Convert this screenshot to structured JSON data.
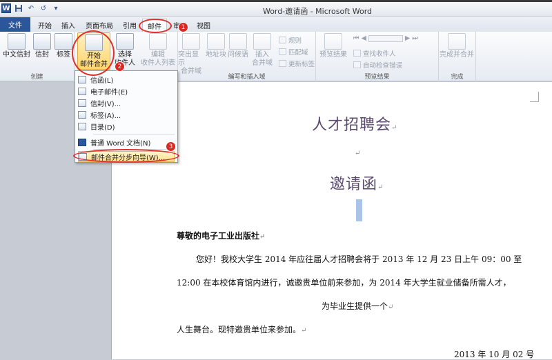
{
  "window": {
    "title": "Word-邀请函 - Microsoft Word",
    "logo_letter": "W"
  },
  "qat": {
    "undo": "↶",
    "redo": "↺",
    "more": "▾"
  },
  "tabs": [
    "文件",
    "开始",
    "插入",
    "页面布局",
    "引用",
    "邮件",
    "审阅",
    "视图"
  ],
  "ribbon": {
    "create": {
      "label": "创建",
      "envelope_cn": "中文信封",
      "envelope": "信封",
      "labels": "标签"
    },
    "start": {
      "line1": "开始",
      "line2": "邮件合并",
      "select1": "选择",
      "select2": "收件人",
      "edit1": "编辑",
      "edit2": "收件人列表",
      "group_label": ""
    },
    "write": {
      "label": "编写和插入域",
      "highlight1": "突出显示",
      "highlight2": "合并域",
      "address": "地址块",
      "greeting": "问候语",
      "insert1": "插入",
      "insert2": "合并域",
      "rules": "规则",
      "match": "匹配域",
      "update": "更新标签"
    },
    "preview": {
      "label": "预览结果",
      "results": "预览结果",
      "find": "查找收件人",
      "check": "自动检查错误"
    },
    "finish": {
      "label": "完成",
      "merge1": "完成并合并"
    }
  },
  "menu": {
    "items": [
      "信函(L)",
      "电子邮件(E)",
      "信封(V)...",
      "标签(A)...",
      "目录(D)",
      "普通 Word 文档(N)",
      "邮件合并分步向导(W)..."
    ]
  },
  "badges": [
    "1",
    "2",
    "3"
  ],
  "document": {
    "title1": "人才招聘会",
    "title2": "邀请函",
    "salutation": "尊敬的电子工业出版社",
    "p1": "您好！我校大学生 2014 年应往届人才招聘会将于 2013 年 12 月 23 日上午 09：00 至",
    "p2": "12:00 在本校体育馆内进行，诚邀贵单位前来参加，为 2014 年大学生就业储备所需人才，",
    "p3": "为毕业生提供一个",
    "p4": "人生舞台。现特邀贵单位来参加。",
    "date": "2013 年 10 月 02 号",
    "para_mark": "↵"
  }
}
